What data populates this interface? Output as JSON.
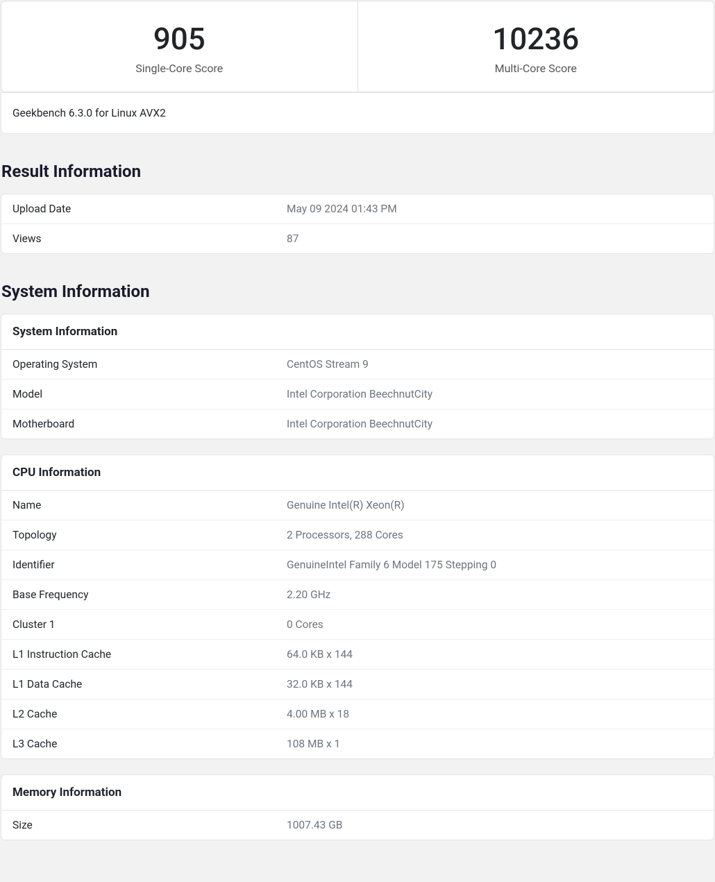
{
  "scores": {
    "single_value": "905",
    "single_label": "Single-Core Score",
    "multi_value": "10236",
    "multi_label": "Multi-Core Score"
  },
  "version": "Geekbench 6.3.0 for Linux AVX2",
  "sections": {
    "result_info": {
      "title": "Result Information",
      "rows": [
        {
          "label": "Upload Date",
          "value": "May 09 2024 01:43 PM"
        },
        {
          "label": "Views",
          "value": "87"
        }
      ]
    },
    "system_info": {
      "title": "System Information",
      "header": "System Information",
      "rows": [
        {
          "label": "Operating System",
          "value": "CentOS Stream 9"
        },
        {
          "label": "Model",
          "value": "Intel Corporation BeechnutCity"
        },
        {
          "label": "Motherboard",
          "value": "Intel Corporation BeechnutCity"
        }
      ]
    },
    "cpu_info": {
      "header": "CPU Information",
      "rows": [
        {
          "label": "Name",
          "value": "Genuine Intel(R) Xeon(R)"
        },
        {
          "label": "Topology",
          "value": "2 Processors, 288 Cores"
        },
        {
          "label": "Identifier",
          "value": "GenuineIntel Family 6 Model 175 Stepping 0"
        },
        {
          "label": "Base Frequency",
          "value": "2.20 GHz"
        },
        {
          "label": "Cluster 1",
          "value": "0 Cores"
        },
        {
          "label": "L1 Instruction Cache",
          "value": "64.0 KB x 144"
        },
        {
          "label": "L1 Data Cache",
          "value": "32.0 KB x 144"
        },
        {
          "label": "L2 Cache",
          "value": "4.00 MB x 18"
        },
        {
          "label": "L3 Cache",
          "value": "108 MB x 1"
        }
      ]
    },
    "memory_info": {
      "header": "Memory Information",
      "rows": [
        {
          "label": "Size",
          "value": "1007.43 GB"
        }
      ]
    }
  }
}
